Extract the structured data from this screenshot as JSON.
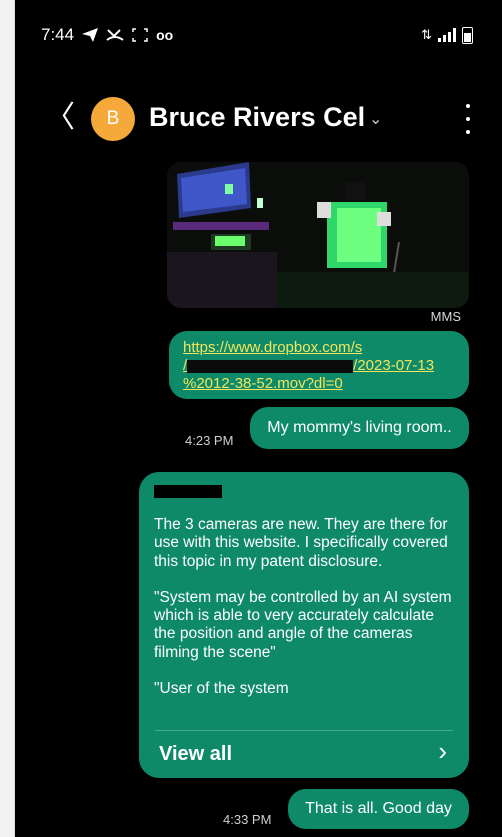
{
  "status_bar": {
    "time": "7:44",
    "icons": [
      "telegram-icon",
      "missed-call-icon",
      "screenshot-icon",
      "voicemail-icon"
    ],
    "right_icons": [
      "data-transfer-icon",
      "signal-icon",
      "battery-icon"
    ],
    "voicemail_glyph": "oo",
    "data_glyph": "⇅"
  },
  "header": {
    "back_glyph": "〈",
    "avatar_letter": "B",
    "contact_name": "Bruce Rivers Cel",
    "dropdown_glyph": "⌄",
    "avatar_color": "#f6a93b"
  },
  "messages": {
    "mms_label": "MMS",
    "link": {
      "line1": "https://www.dropbox.com/s",
      "line2_prefix": "/",
      "line2_suffix": "/2023-07-13",
      "line3": "%2012-38-52.mov?dl=0"
    },
    "msg1": {
      "text": "My mommy's living room..",
      "time": "4:23 PM"
    },
    "long": {
      "paragraphs": [
        "The 3 cameras are new.  They are there for use with this website.  I specifically covered this topic in my patent disclosure.",
        "\"System may be controlled by an AI system which is able to very accurately calculate the position and angle of the cameras filming the scene\"",
        "\"User of the system"
      ],
      "view_all": "View all",
      "chevron": "›"
    },
    "msg2": {
      "text": "That is all.  Good day",
      "time": "4:33 PM"
    }
  },
  "colors": {
    "bubble": "#0e8a68",
    "link": "#f2e55d",
    "background": "#000000"
  }
}
